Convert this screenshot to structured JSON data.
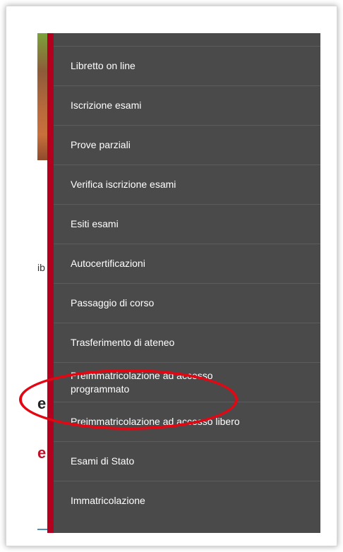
{
  "background": {
    "fragment_left_text": "ib",
    "fragment_heading": "e",
    "fragment_heading_red": "e"
  },
  "menu": {
    "accent_color": "#b3001e",
    "background_color": "#4a4a4a",
    "items": [
      {
        "label": "Libretto on line"
      },
      {
        "label": "Iscrizione esami"
      },
      {
        "label": "Prove parziali"
      },
      {
        "label": "Verifica iscrizione esami"
      },
      {
        "label": "Esiti esami"
      },
      {
        "label": "Autocertificazioni"
      },
      {
        "label": "Passaggio di corso"
      },
      {
        "label": "Trasferimento di ateneo"
      },
      {
        "label": "Preimmatricolazione ad accesso programmato"
      },
      {
        "label": "Preimmatricolazione ad accesso libero"
      },
      {
        "label": "Esami di Stato"
      },
      {
        "label": "Immatricolazione"
      }
    ]
  },
  "annotation": {
    "color": "#e30613",
    "highlighted_item": "Preimmatricolazione ad accesso programmato"
  }
}
